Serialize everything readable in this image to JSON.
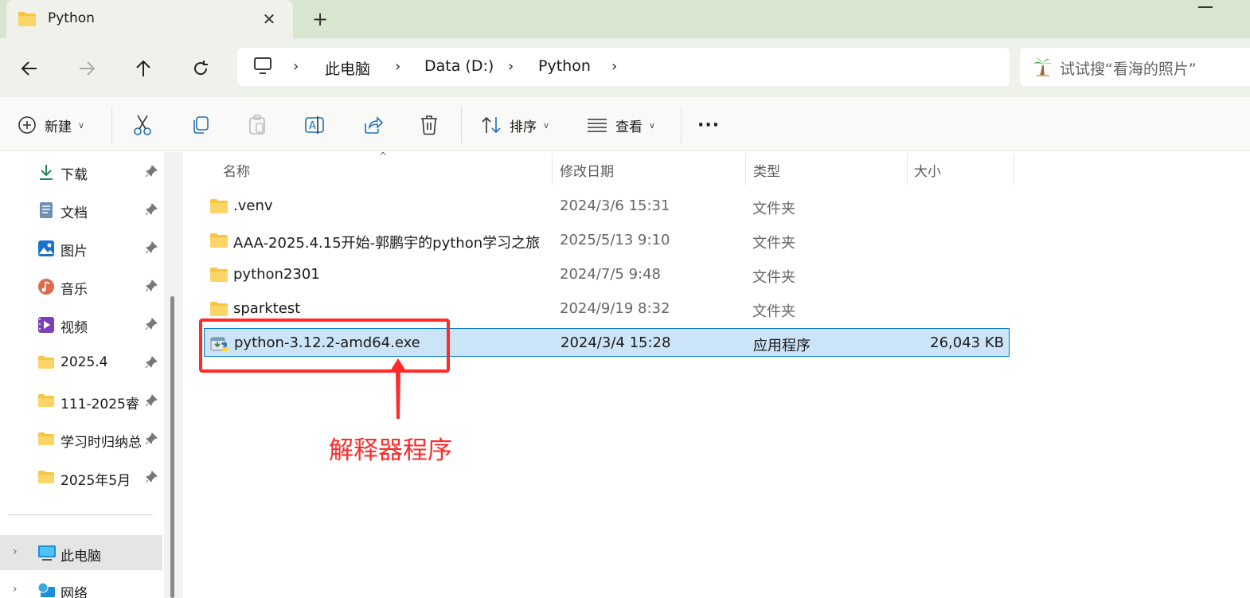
{
  "window": {
    "tab_title": "Python",
    "new_tab": "+",
    "close": "✕"
  },
  "breadcrumb": {
    "items": [
      "此电脑",
      "Data (D:)",
      "Python"
    ],
    "separator": "›"
  },
  "search": {
    "placeholder": "试试搜“看海的照片”"
  },
  "commandbar": {
    "new_label": "新建",
    "sort_label": "排序",
    "view_label": "查看",
    "more": "···"
  },
  "sidebar": {
    "items": [
      {
        "label": "下载",
        "icon": "download-icon"
      },
      {
        "label": "文档",
        "icon": "document-icon"
      },
      {
        "label": "图片",
        "icon": "pictures-icon"
      },
      {
        "label": "音乐",
        "icon": "music-icon"
      },
      {
        "label": "视频",
        "icon": "video-icon"
      },
      {
        "label": "2025.4",
        "icon": "folder-icon"
      },
      {
        "label": "111-2025睿",
        "icon": "folder-icon"
      },
      {
        "label": "学习时归纳总",
        "icon": "folder-icon"
      },
      {
        "label": "2025年5月",
        "icon": "folder-icon"
      }
    ],
    "this_pc": "此电脑",
    "network": "网络"
  },
  "columns": {
    "name": "名称",
    "modified": "修改日期",
    "type": "类型",
    "size": "大小"
  },
  "files": [
    {
      "name": ".venv",
      "modified": "2024/3/6 15:31",
      "type": "文件夹",
      "size": "",
      "kind": "folder"
    },
    {
      "name": "AAA-2025.4.15开始-郭鹏宇的python学习之旅",
      "modified": "2025/5/13 9:10",
      "type": "文件夹",
      "size": "",
      "kind": "folder"
    },
    {
      "name": "python2301",
      "modified": "2024/7/5 9:48",
      "type": "文件夹",
      "size": "",
      "kind": "folder"
    },
    {
      "name": "sparktest",
      "modified": "2024/9/19 8:32",
      "type": "文件夹",
      "size": "",
      "kind": "folder"
    },
    {
      "name": "python-3.12.2-amd64.exe",
      "modified": "2024/3/4 15:28",
      "type": "应用程序",
      "size": "26,043 KB",
      "kind": "exe"
    }
  ],
  "annotation": {
    "text": "解释器程序",
    "color": "#ff2a2a"
  },
  "colors": {
    "accent": "#0078d4",
    "selection": "#cce4f7",
    "folder": "#f8c542"
  }
}
